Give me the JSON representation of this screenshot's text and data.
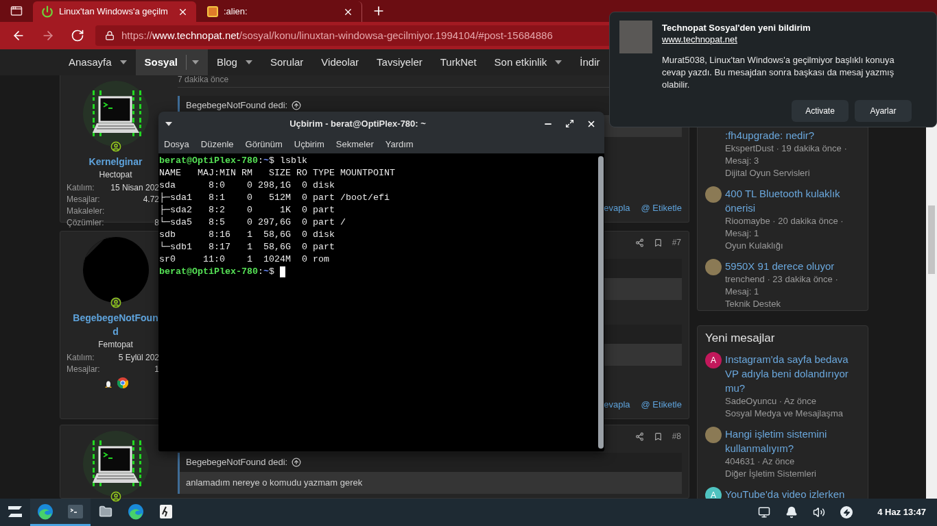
{
  "browser": {
    "tabs": [
      {
        "label": "Linux'tan Windows'a geçilm",
        "selected": true,
        "kind": "power"
      },
      {
        "label": ":alien:",
        "selected": false,
        "kind": "emoji"
      }
    ],
    "nav_buttons": [
      {
        "kind": "back",
        "disabled": false
      },
      {
        "kind": "forward",
        "disabled": true
      },
      {
        "kind": "reload",
        "disabled": false
      }
    ],
    "url": {
      "scheme": "https://",
      "host": "www.technopat.net",
      "path": "/sosyal/konu/linuxtan-windowsa-gecilmiyor.1994104/#post-15684886"
    }
  },
  "site_nav": [
    {
      "label": "Anasayfa",
      "selected": false,
      "menu": true
    },
    {
      "label": "Sosyal",
      "selected": true,
      "menu": true
    },
    {
      "label": "Blog",
      "selected": false,
      "menu": true
    },
    {
      "label": "Sorular",
      "selected": false,
      "menu": false
    },
    {
      "label": "Videolar",
      "selected": false,
      "menu": false
    },
    {
      "label": "Tavsiyeler",
      "selected": false,
      "menu": false
    },
    {
      "label": "TurkNet",
      "selected": false,
      "menu": false
    },
    {
      "label": "Son etkinlik",
      "selected": false,
      "menu": true
    },
    {
      "label": "İndir",
      "selected": false,
      "menu": false
    }
  ],
  "posts": [
    {
      "user": {
        "name": "Kernelginar",
        "rank": "Hectopat",
        "kind": "laptop",
        "stats": [
          {
            "label": "Katılım:",
            "value": "15 Nisan 202"
          },
          {
            "label": "Mesajlar:",
            "value": "4.72"
          },
          {
            "label": "Makaleler:"
          },
          {
            "label": "Çözümler:",
            "value": "8"
          }
        ]
      },
      "time": "7 dakika önce",
      "quotes": [
        {
          "kind": "quote",
          "author": "BegebegeNotFound dedi:"
        }
      ],
      "actions": [
        "evapla",
        "@ Etiketle"
      ]
    },
    {
      "user": {
        "name": "BegebegeNotFound",
        "rank": "Femtopat",
        "kind": "dark",
        "stats": [
          {
            "label": "Katılım:",
            "value": "5 Eylül 202"
          },
          {
            "label": "Mesajlar:",
            "value": "1"
          }
        ],
        "badges": [
          {
            "kind": "penguin"
          },
          {
            "kind": "chrome"
          }
        ]
      },
      "number": "#7",
      "quotes": [
        {
          "kind": "quote"
        },
        {
          "kind": "quote"
        }
      ],
      "actions": [
        "evapla",
        "@ Etiketle"
      ]
    },
    {
      "user": {
        "kind": "laptop"
      },
      "number": "#8",
      "quotes": [
        {
          "kind": "quote",
          "author": "BegebegeNotFound dedi:",
          "body": "anlamadım nereye o komudu yazmam gerek"
        }
      ]
    }
  ],
  "sidebar": [
    {
      "items": [
        {
          "title": ":fh4upgrade: nedir?",
          "meta": "EkspertDust · 19 dakika önce ·",
          "count": "Mesaj: 3",
          "forum": "Dijital Oyun Servisleri"
        },
        {
          "avatar": {
            "kind": "photo"
          },
          "title": "400 TL Bluetooth kulaklık önerisi",
          "meta": "Rioomaybe · 20 dakika önce ·",
          "count": "Mesaj: 1",
          "forum": "Oyun Kulaklığı"
        },
        {
          "avatar": {
            "kind": "photo"
          },
          "title": "5950X 91 derece oluyor",
          "meta": "trenchend · 23 dakika önce ·",
          "count": "Mesaj: 1",
          "forum": "Teknik Destek"
        }
      ]
    },
    {
      "title": "Yeni mesajlar",
      "items": [
        {
          "avatar": {
            "kind": "letter",
            "letter": "A"
          },
          "color": "#c2185b",
          "title": "Instagram'da sayfa bedava VP adıyla beni dolandırıyor mu?",
          "meta": "SadeOyuncu · Az önce",
          "forum": "Sosyal Medya ve Mesajlaşma"
        },
        {
          "avatar": {
            "kind": "photo"
          },
          "title": "Hangi işletim sistemini kullanmalıyım?",
          "meta": "404631 · Az önce",
          "forum": "Diğer İşletim Sistemleri"
        },
        {
          "avatar": {
            "kind": "letter",
            "letter": "A"
          },
          "color": "#4fc3c0",
          "title": "YouTube'da video izlerken"
        }
      ]
    }
  ],
  "terminal": {
    "title": "Uçbirim - berat@OptiPlex-780: ~",
    "menu": [
      "Dosya",
      "Düzenle",
      "Görünüm",
      "Uçbirim",
      "Sekmeler",
      "Yardım"
    ],
    "lines": [
      {
        "kind": "prompt",
        "user": "berat@OptiPlex-780",
        "sep": ":",
        "path": "~",
        "sign": "$",
        "command": "lsblk",
        "cursor": false
      },
      {
        "kind": "output",
        "text": "NAME   MAJ:MIN RM   SIZE RO TYPE MOUNTPOINT"
      },
      {
        "kind": "output",
        "text": "sda      8:0    0 298,1G  0 disk"
      },
      {
        "kind": "output",
        "text": "├─sda1   8:1    0   512M  0 part /boot/efi"
      },
      {
        "kind": "output",
        "text": "├─sda2   8:2    0     1K  0 part"
      },
      {
        "kind": "output",
        "text": "└─sda5   8:5    0 297,6G  0 part /"
      },
      {
        "kind": "output",
        "text": "sdb      8:16   1  58,6G  0 disk"
      },
      {
        "kind": "output",
        "text": "└─sdb1   8:17   1  58,6G  0 part"
      },
      {
        "kind": "output",
        "text": "sr0     11:0    1  1024M  0 rom"
      },
      {
        "kind": "prompt",
        "user": "berat@OptiPlex-780",
        "sep": ":",
        "path": "~",
        "sign": "$",
        "cursor": true
      }
    ]
  },
  "notification": {
    "title": "Technopat Sosyal'den yeni bildirim",
    "link": "www.technopat.net",
    "body": "Murat5038, Linux'tan Windows'a geçilmiyor başlıklı konuya cevap yazdı. Bu mesajdan sonra başkası da mesaj yazmış olabilir.",
    "buttons": [
      "Activate",
      "Ayarlar"
    ]
  },
  "taskbar": {
    "apps": [
      {
        "kind": "launcher",
        "active": false
      },
      {
        "kind": "browser",
        "active": true
      },
      {
        "kind": "terminal",
        "active": true
      },
      {
        "kind": "files",
        "active": false
      },
      {
        "kind": "browser",
        "active": false
      },
      {
        "kind": "game",
        "active": false
      }
    ],
    "tray": [
      {
        "kind": "display"
      },
      {
        "kind": "bell"
      },
      {
        "kind": "volume"
      },
      {
        "kind": "power"
      }
    ],
    "clock": "4 Haz 13:47"
  }
}
